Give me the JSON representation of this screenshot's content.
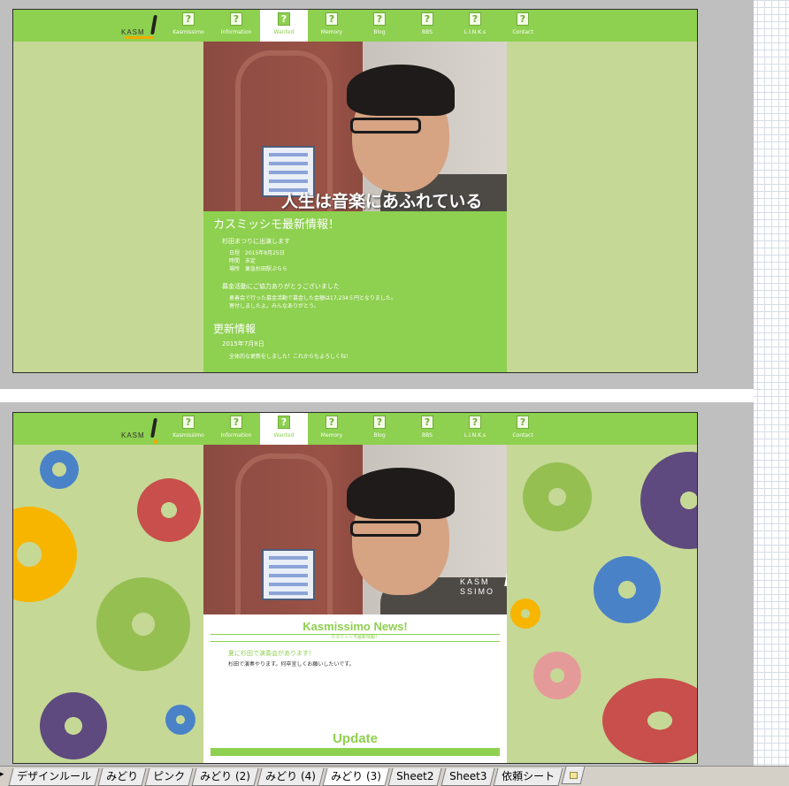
{
  "nav": {
    "logo": "KASM",
    "items": [
      {
        "label": "Kasmissimo",
        "icon": "?"
      },
      {
        "label": "Information",
        "icon": "?"
      },
      {
        "label": "Wanted",
        "icon": "?"
      },
      {
        "label": "Memory",
        "icon": "?"
      },
      {
        "label": "Blog",
        "icon": "?"
      },
      {
        "label": "BBS",
        "icon": "?"
      },
      {
        "label": "L.I.N.K.s",
        "icon": "?"
      },
      {
        "label": "Contact",
        "icon": "?"
      }
    ],
    "active": "Wanted"
  },
  "page1": {
    "catchcopy": "人生は音楽にあふれている",
    "news_title": "カスミッシモ最新情報！",
    "item1_title": "杉田まつりに出演します",
    "item1_lines": [
      "日程　2015年8月25日",
      "時間　未定",
      "場所　東急杉田駅ぷらら"
    ],
    "item2_title": "募金活動にご協力ありがとうございました",
    "item2_lines": [
      "恵善会で行った募金活動で募金した金額は17,234５円となりました。",
      "寄付しましたよ。みんなありがとう。"
    ],
    "update_title": "更新情報",
    "update_date": "2015年7月8日",
    "update_text": "全体的な更新をしました！これからもよろしくね！"
  },
  "page2": {
    "photo_logo_line1": "KASM",
    "photo_logo_line2": "SSIMO",
    "news_title": "Kasmissimo News!",
    "news_tagline": "カスミッシモ最新情報！",
    "item_title": "夏に杉田で演奏会があります！",
    "item_text": "杉田で演奏やります。何卒宜しくお願いしたいです。",
    "update_title": "Update"
  },
  "sheet_tabs": [
    "デザインルール",
    "みどり",
    "ピンク",
    "みどり (2)",
    "みどり (4)",
    "みどり (3)",
    "Sheet2",
    "Sheet3",
    "依頼シート"
  ],
  "active_tab": "みどり (3)",
  "colors": {
    "nav_green": "#8ed04f",
    "page_bg": "#c5d896",
    "disc_blue": "#4a82c8",
    "disc_red": "#c84f4b",
    "disc_yellow": "#f7b500",
    "disc_olive": "#96bf52",
    "disc_purple": "#5e4a7e",
    "disc_pink": "#e59a9a"
  }
}
